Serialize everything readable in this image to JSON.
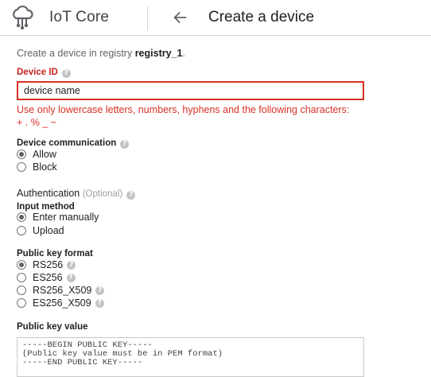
{
  "header": {
    "app_name": "IoT Core",
    "page_title": "Create a device"
  },
  "intro": {
    "prefix": "Create a device in registry ",
    "registry": "registry_1",
    "suffix": "."
  },
  "device_id": {
    "label": "Device ID",
    "value": "device name",
    "error_line1": "Use only lowercase letters, numbers, hyphens and the following characters:",
    "error_line2": "+ . % _ ~"
  },
  "communication": {
    "label": "Device communication",
    "options": [
      "Allow",
      "Block"
    ],
    "selected": "Allow"
  },
  "authentication": {
    "title": "Authentication",
    "optional": "(Optional)",
    "input_method_label": "Input method",
    "input_methods": [
      "Enter manually",
      "Upload"
    ],
    "input_method_selected": "Enter manually",
    "key_format_label": "Public key format",
    "key_formats": [
      "RS256",
      "ES256",
      "RS256_X509",
      "ES256_X509"
    ],
    "key_format_selected": "RS256",
    "key_value_label": "Public key value",
    "key_value_line1": "-----BEGIN PUBLIC KEY-----",
    "key_value_line2": "(Public key value must be in PEM format)",
    "key_value_line3": "-----END PUBLIC KEY-----"
  },
  "colors": {
    "error": "#d93025",
    "text": "#212121",
    "muted": "#5f6368"
  }
}
